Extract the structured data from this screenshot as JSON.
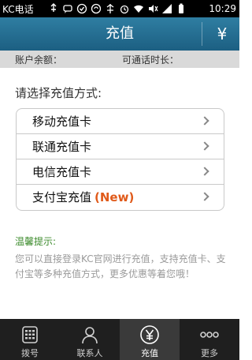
{
  "status_bar": {
    "carrier": "KC电话",
    "time": "10:29",
    "icons": [
      "usb-icon",
      "sms-icon",
      "check-icon",
      "sync-icon",
      "usb-debug-icon",
      "alarm-icon",
      "wifi-icon",
      "mute-icon",
      "signal-icon",
      "battery-icon"
    ]
  },
  "header": {
    "title": "充值",
    "right_icon_glyph": "¥"
  },
  "balance_bar": {
    "account_balance_label": "账户余额：",
    "talk_time_label": "可通话时长："
  },
  "main": {
    "prompt": "请选择充值方式:",
    "options": [
      {
        "label": "移动充值卡",
        "badge": ""
      },
      {
        "label": "联通充值卡",
        "badge": ""
      },
      {
        "label": "电信充值卡",
        "badge": ""
      },
      {
        "label": "支付宝充值",
        "badge": "(New)"
      }
    ],
    "tip_title": "温馨提示:",
    "tip_text": "您可以直接登录KC官网进行充值，支持充值卡、支付宝等多种充值方式，更多优惠等着您哦！"
  },
  "tab_bar": {
    "tabs": [
      {
        "label": "拨号",
        "icon": "dialpad-icon"
      },
      {
        "label": "联系人",
        "icon": "contacts-icon"
      },
      {
        "label": "充值",
        "icon": "recharge-yen-icon"
      },
      {
        "label": "更多",
        "icon": "more-icon"
      }
    ],
    "active_index": 2
  },
  "colors": {
    "header_top": "#2f7ea2",
    "header_bottom": "#1c5f82",
    "tip_title": "#3c8b2c",
    "new_badge": "#e05a1a",
    "tab_bar": "#1f1f1f"
  }
}
